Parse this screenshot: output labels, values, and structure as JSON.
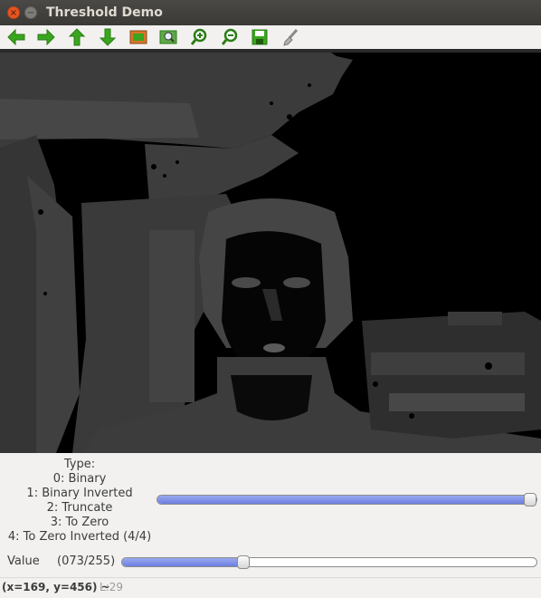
{
  "window": {
    "title": "Threshold Demo",
    "close_glyph": "×",
    "minimize_glyph": "−"
  },
  "toolbar": {
    "buttons": [
      {
        "name": "pan-left-icon",
        "color": "#3aa51e"
      },
      {
        "name": "pan-right-icon",
        "color": "#3aa51e"
      },
      {
        "name": "pan-up-icon",
        "color": "#3aa51e"
      },
      {
        "name": "pan-down-icon",
        "color": "#3aa51e"
      },
      {
        "name": "zoom-fit-icon",
        "color": "#d8762a"
      },
      {
        "name": "zoom-original-icon",
        "color": "#3aa51e"
      },
      {
        "name": "zoom-in-icon",
        "color": "#3aa51e"
      },
      {
        "name": "zoom-out-icon",
        "color": "#3aa51e"
      },
      {
        "name": "save-icon",
        "color": "#3aa51e"
      },
      {
        "name": "properties-brush-icon",
        "color": "#8a8a8a"
      }
    ]
  },
  "controls": {
    "type": {
      "lines": [
        "Type:",
        "0: Binary",
        "1: Binary Inverted",
        "2: Truncate",
        "3: To Zero",
        "4: To Zero Inverted (4/4)"
      ],
      "value": 4,
      "max": 4
    },
    "value": {
      "label": "Value",
      "count_text": "(073/255)",
      "value": 73,
      "max": 255
    }
  },
  "statusbar": {
    "coords": "(x=169, y=456) ~",
    "level": "L:29"
  },
  "colors": {
    "slider_fill": "#6d7fe0",
    "titlebar": "#3c3b37",
    "close_button": "#e95420"
  }
}
